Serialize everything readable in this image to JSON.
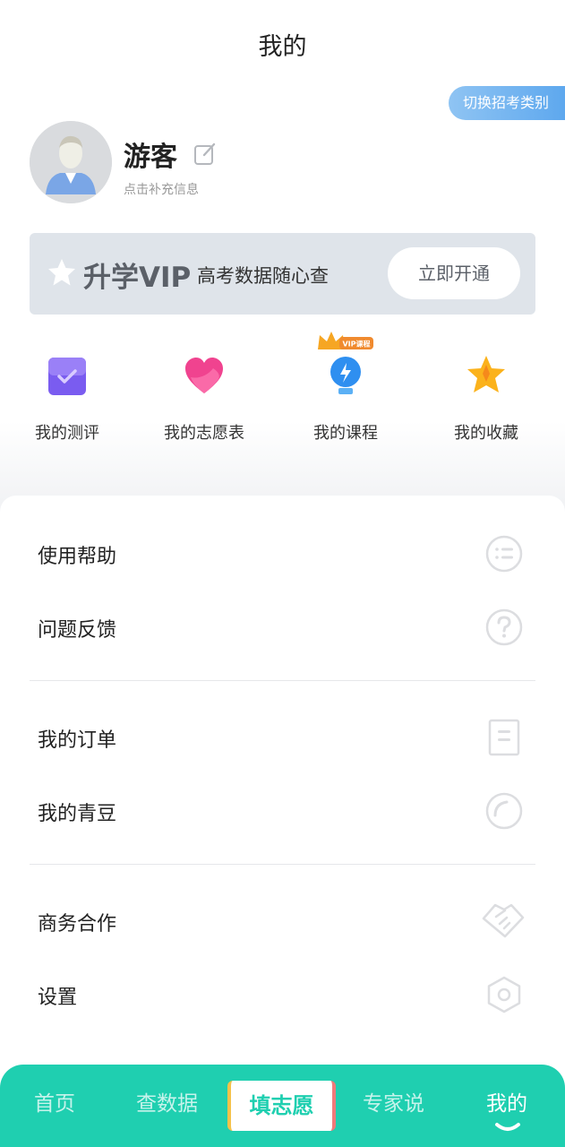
{
  "header": {
    "title": "我的"
  },
  "switch_exam": {
    "label": "切换招考类别"
  },
  "profile": {
    "username": "游客",
    "hint": "点击补充信息"
  },
  "vip": {
    "title": "升学VIP",
    "description": "高考数据随心查",
    "button_label": "立即开通"
  },
  "quick_actions": [
    {
      "label": "我的测评",
      "icon": "assessment-icon"
    },
    {
      "label": "我的志愿表",
      "icon": "heart-icon"
    },
    {
      "label": "我的课程",
      "icon": "lightbulb-icon",
      "badge": "VIP课程"
    },
    {
      "label": "我的收藏",
      "icon": "star-icon"
    }
  ],
  "menu": {
    "group1": [
      {
        "label": "使用帮助",
        "icon": "list-icon"
      },
      {
        "label": "问题反馈",
        "icon": "question-icon"
      }
    ],
    "group2": [
      {
        "label": "我的订单",
        "icon": "document-icon"
      },
      {
        "label": "我的青豆",
        "icon": "bean-icon"
      }
    ],
    "group3": [
      {
        "label": "商务合作",
        "icon": "handshake-icon"
      },
      {
        "label": "设置",
        "icon": "settings-hexagon-icon"
      }
    ]
  },
  "tabbar": {
    "tabs": [
      {
        "label": "首页"
      },
      {
        "label": "查数据"
      },
      {
        "label": "填志愿"
      },
      {
        "label": "专家说"
      },
      {
        "label": "我的"
      }
    ],
    "active_index": 4
  },
  "colors": {
    "accent": "#1fcfb0",
    "vip_bg": "#dfe4ea",
    "switch_blue": "#5ea8ee"
  }
}
